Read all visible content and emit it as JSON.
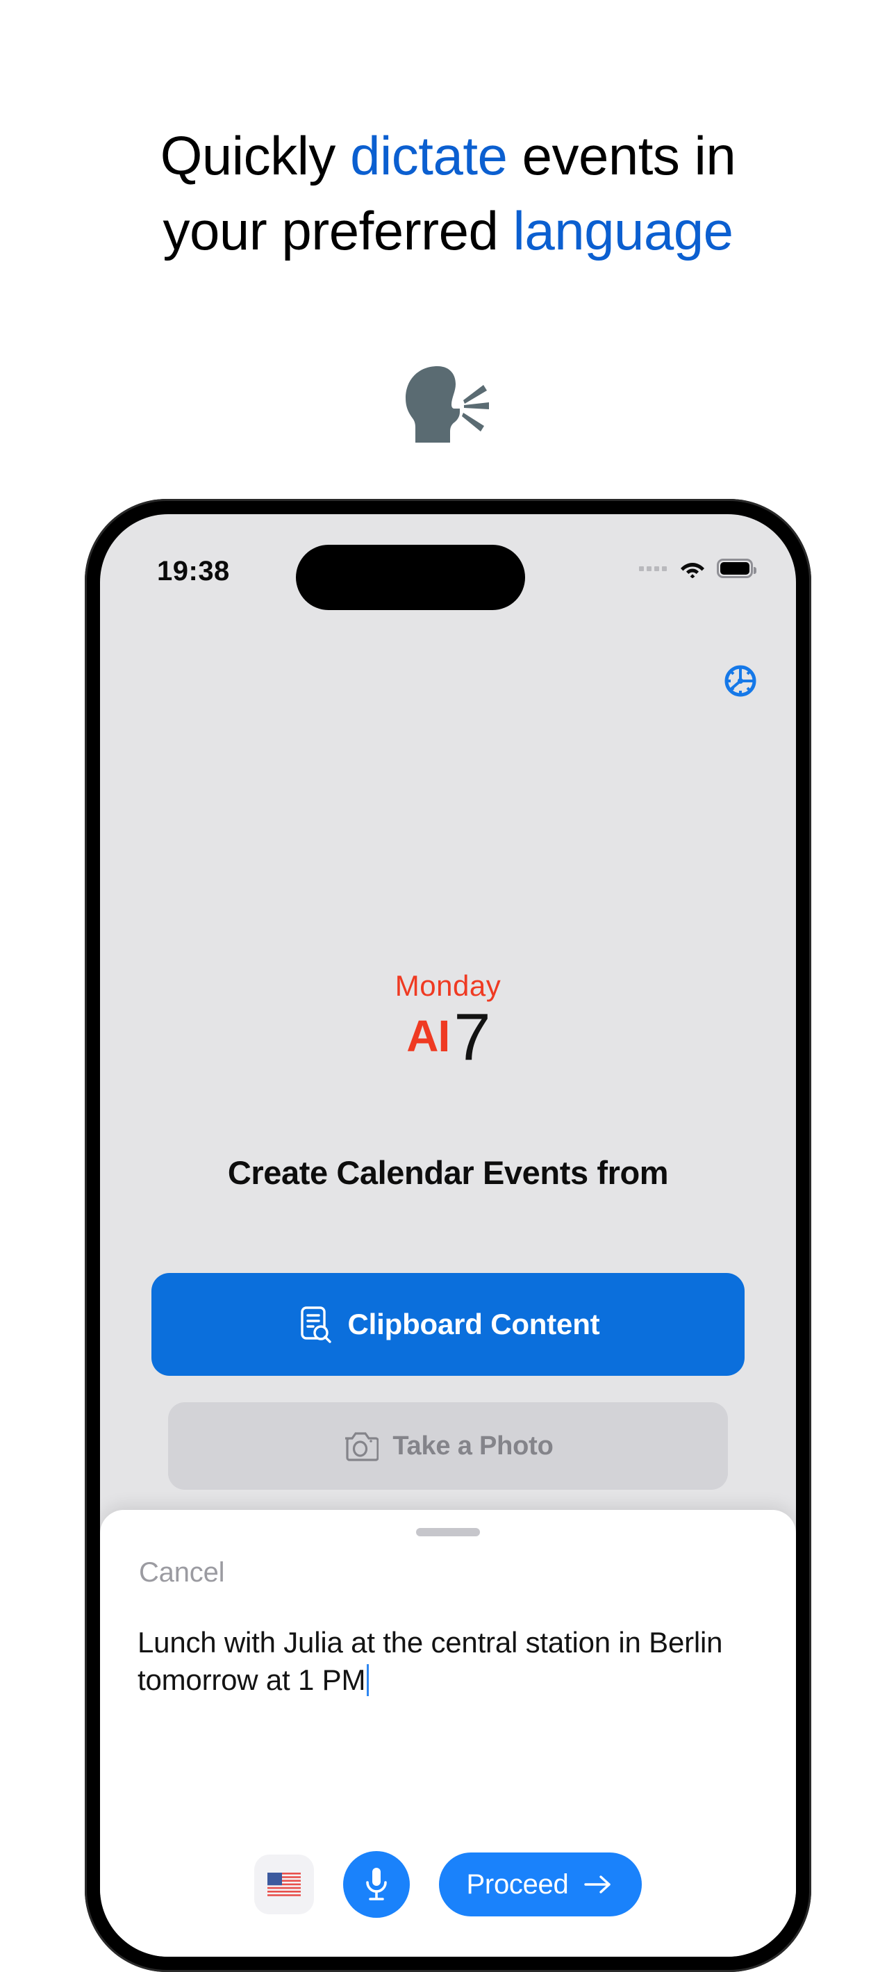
{
  "headline": {
    "line1_pre": "Quickly ",
    "line1_accent": "dictate",
    "line1_post": " events in",
    "line2_pre": "your preferred ",
    "line2_accent": "language",
    "accent_color": "#0b5fd0"
  },
  "hero_icon": {
    "name": "speaking-head-icon",
    "glyph": "speaking-head",
    "color": "#5a6b72"
  },
  "phone": {
    "status_bar": {
      "time": "19:38",
      "cellular_icon": "signal-dots-icon",
      "wifi_icon": "wifi-icon",
      "battery_icon": "battery-icon"
    },
    "settings_icon": {
      "name": "gear-icon",
      "color": "#1578e8"
    },
    "logo": {
      "weekday": "Monday",
      "ai_text": "AI",
      "day_number": "7",
      "red": "#ef3a22"
    },
    "title": "Create Calendar Events from",
    "buttons": [
      {
        "id": "clipboard-content",
        "label": "Clipboard Content",
        "icon": "clipboard-search-icon",
        "bg": "#0b6fdc",
        "fg": "#ffffff",
        "enabled": true
      },
      {
        "id": "take-a-photo",
        "label": "Take a Photo",
        "icon": "camera-icon",
        "bg": "#d3d3d7",
        "fg": "#84848a",
        "enabled": false
      }
    ],
    "sheet": {
      "handle": "drag-handle",
      "cancel_label": "Cancel",
      "dictated_text": "Lunch with Julia at the central station in Berlin tomorrow at 1 PM",
      "caret_color": "#2e86f0",
      "controls": {
        "language_flag": "🇺🇸",
        "language_flag_name": "us-flag-icon",
        "mic_icon": "microphone-icon",
        "proceed_label": "Proceed",
        "proceed_arrow_icon": "arrow-right-icon",
        "accent": "#1a82fb"
      }
    }
  }
}
